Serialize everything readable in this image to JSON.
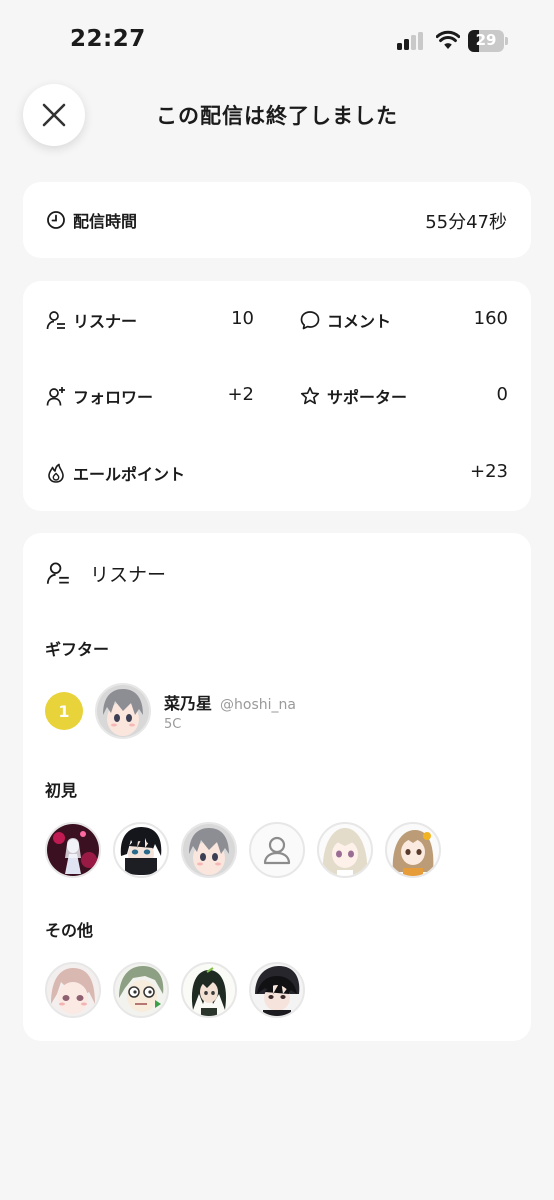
{
  "status": {
    "time": "22:27",
    "battery": "29"
  },
  "header": {
    "title": "この配信は終了しました"
  },
  "duration": {
    "label": "配信時間",
    "value": "55分47秒"
  },
  "stats": {
    "listeners": {
      "label": "リスナー",
      "value": "10"
    },
    "comments": {
      "label": "コメント",
      "value": "160"
    },
    "followers": {
      "label": "フォロワー",
      "value": "+2"
    },
    "supporters": {
      "label": "サポーター",
      "value": "0"
    },
    "ale_points": {
      "label": "エールポイント",
      "value": "+23"
    }
  },
  "listener_section": {
    "title": "リスナー",
    "gifter_heading": "ギフター",
    "gifter": {
      "rank": "1",
      "name": "菜乃星",
      "handle": "@hoshi_na",
      "amount": "5C"
    },
    "first_time_heading": "初見",
    "others_heading": "その他"
  },
  "icons": {
    "close": "close-icon",
    "clock": "clock-icon",
    "listener": "person-lines-icon",
    "comment": "speech-bubble-icon",
    "follower": "person-plus-icon",
    "supporter": "star-icon",
    "ale": "flame-icon",
    "default_avatar": "person-icon"
  }
}
